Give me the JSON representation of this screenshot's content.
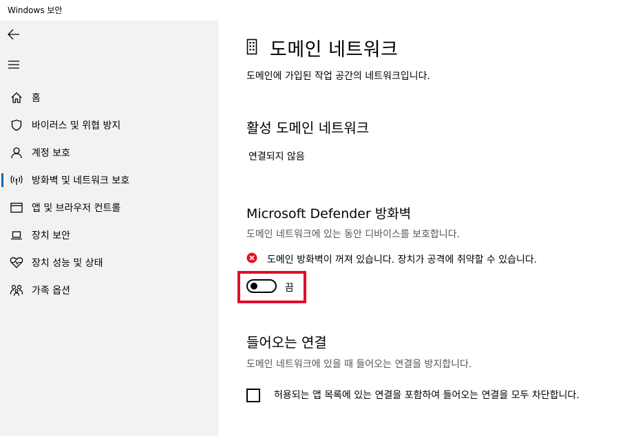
{
  "window": {
    "title": "Windows 보안"
  },
  "sidebar": {
    "back_icon": "back-arrow-icon",
    "menu_icon": "hamburger-menu-icon",
    "items": [
      {
        "label": "홈",
        "icon": "home-icon",
        "active": false
      },
      {
        "label": "바이러스 및 위협 방지",
        "icon": "shield-icon",
        "active": false
      },
      {
        "label": "계정 보호",
        "icon": "person-icon",
        "active": false
      },
      {
        "label": "방화벽 및 네트워크 보호",
        "icon": "wifi-antenna-icon",
        "active": true
      },
      {
        "label": "앱 및 브라우저 컨트롤",
        "icon": "app-window-icon",
        "active": false
      },
      {
        "label": "장치 보안",
        "icon": "laptop-icon",
        "active": false
      },
      {
        "label": "장치 성능 및 상태",
        "icon": "heart-pulse-icon",
        "active": false
      },
      {
        "label": "가족 옵션",
        "icon": "family-icon",
        "active": false
      }
    ]
  },
  "main": {
    "title": "도메인 네트워크",
    "title_icon": "building-icon",
    "description": "도메인에 가입된 작업 공간의 네트워크입니다.",
    "active_networks": {
      "heading": "활성 도메인 네트워크",
      "value": "연결되지 않음"
    },
    "firewall": {
      "heading": "Microsoft Defender 방화벽",
      "description": "도메인 네트워크에 있는 동안 디바이스를 보호합니다.",
      "warning_icon": "error-x-icon",
      "warning_text": "도메인 방화벽이 꺼져 있습니다. 장치가 공격에 취약할 수 있습니다.",
      "toggle_state": "off",
      "toggle_label": "끔"
    },
    "incoming": {
      "heading": "들어오는 연결",
      "description": "도메인 네트워크에 있을 때 들어오는 연결을 방지합니다.",
      "checkbox_label": "허용되는 앱 목록에 있는 연결을 포함하여 들어오는 연결을 모두 차단합니다.",
      "checkbox_checked": false
    }
  },
  "colors": {
    "sidebar_bg": "#f2f2f2",
    "accent": "#0067b8",
    "error_red": "#e81123",
    "highlight_red": "#e00d2a"
  }
}
